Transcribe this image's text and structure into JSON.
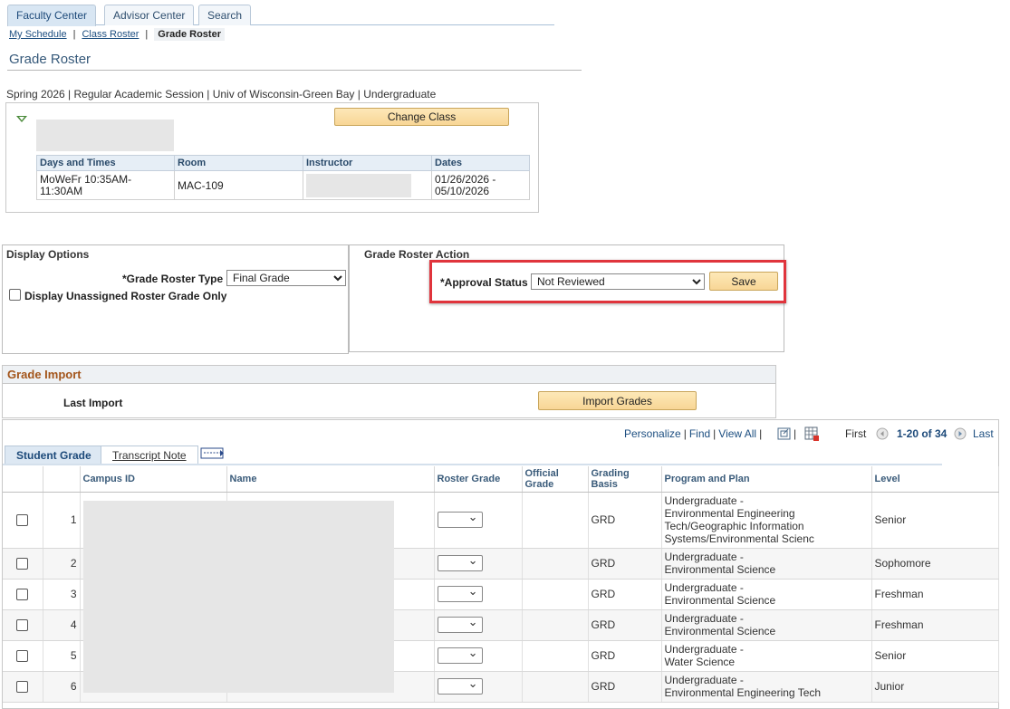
{
  "tabs": [
    {
      "label": "Faculty Center",
      "active": true
    },
    {
      "label": "Advisor Center",
      "active": false
    },
    {
      "label": "Search",
      "active": false
    }
  ],
  "subnav": {
    "my_schedule": "My Schedule",
    "class_roster": "Class Roster",
    "grade_roster": "Grade Roster",
    "separator": "|"
  },
  "page_title": "Grade Roster",
  "term_line": "Spring 2026 | Regular Academic Session | Univ of Wisconsin-Green Bay | Undergraduate",
  "class_info": {
    "change_class_label": "Change Class",
    "headers": [
      "Days and Times",
      "Room",
      "Instructor",
      "Dates"
    ],
    "days_times": "MoWeFr 10:35AM-\n11:30AM",
    "room": "MAC-109",
    "dates": "01/26/2026 -\n05/10/2026"
  },
  "display_options": {
    "title": "Display Options",
    "grade_roster_type_label": "*Grade Roster Type",
    "grade_roster_type_value": "Final Grade",
    "unassigned_only_label": "Display Unassigned Roster Grade Only"
  },
  "action": {
    "title": "Grade Roster Action",
    "approval_status_label": "*Approval Status",
    "approval_status_value": "Not Reviewed",
    "save_label": "Save"
  },
  "grade_import": {
    "title": "Grade Import",
    "last_import_label": "Last Import",
    "import_button": "Import Grades"
  },
  "grid_nav": {
    "personalize": "Personalize",
    "find": "Find",
    "view_all": "View All",
    "first": "First",
    "range": "1-20 of 34",
    "last": "Last"
  },
  "grid_tabs": {
    "student_grade": "Student Grade",
    "transcript_note": "Transcript Note"
  },
  "columns": [
    "Campus ID",
    "Name",
    "Roster Grade",
    "Official\nGrade",
    "Grading Basis",
    "Program and Plan",
    "Level"
  ],
  "rows": [
    {
      "num": "1",
      "basis": "GRD",
      "plan": "Undergraduate -\nEnvironmental Engineering\nTech/Geographic Information\nSystems/Environmental Scienc",
      "level": "Senior"
    },
    {
      "num": "2",
      "basis": "GRD",
      "plan": "Undergraduate -\nEnvironmental Science",
      "level": "Sophomore"
    },
    {
      "num": "3",
      "basis": "GRD",
      "plan": "Undergraduate -\nEnvironmental Science",
      "level": "Freshman"
    },
    {
      "num": "4",
      "basis": "GRD",
      "plan": "Undergraduate -\nEnvironmental Science",
      "level": "Freshman"
    },
    {
      "num": "5",
      "basis": "GRD",
      "plan": "Undergraduate -\nWater Science",
      "level": "Senior"
    },
    {
      "num": "6",
      "basis": "GRD",
      "plan": "Undergraduate -\nEnvironmental Engineering Tech",
      "level": "Junior"
    }
  ]
}
